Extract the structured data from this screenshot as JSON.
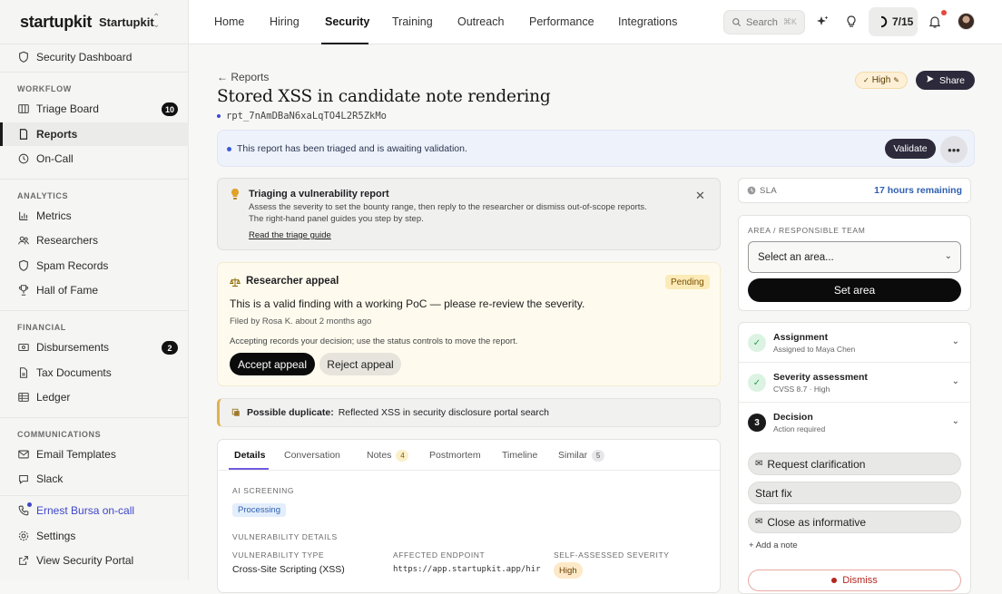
{
  "brand": {
    "logo_text": "startupkit",
    "org_name": "Startupkit"
  },
  "sidebar": {
    "top_item": {
      "label": "Security Dashboard",
      "icon": "shield-icon"
    },
    "sections": [
      {
        "title": "WORKFLOW",
        "items": [
          {
            "label": "Triage Board",
            "icon": "board-icon",
            "badge": "10"
          },
          {
            "label": "Reports",
            "icon": "document-icon",
            "active": true
          },
          {
            "label": "On-Call",
            "icon": "pager-icon"
          }
        ]
      },
      {
        "title": "ANALYTICS",
        "items": [
          {
            "label": "Metrics",
            "icon": "chart-icon"
          },
          {
            "label": "Researchers",
            "icon": "people-icon"
          },
          {
            "label": "Spam Records",
            "icon": "shield-icon"
          },
          {
            "label": "Hall of Fame",
            "icon": "trophy-icon"
          }
        ]
      },
      {
        "title": "FINANCIAL",
        "items": [
          {
            "label": "Disbursements",
            "icon": "money-icon",
            "badge": "2"
          },
          {
            "label": "Tax Documents",
            "icon": "file-icon"
          },
          {
            "label": "Ledger",
            "icon": "ledger-icon"
          }
        ]
      },
      {
        "title": "COMMUNICATIONS",
        "items": [
          {
            "label": "Email Templates",
            "icon": "mail-icon"
          },
          {
            "label": "Slack",
            "icon": "slack-icon"
          }
        ]
      }
    ],
    "footer": [
      {
        "label": "Ernest Bursa on-call",
        "icon": "phone-icon"
      },
      {
        "label": "Settings",
        "icon": "gear-icon"
      },
      {
        "label": "View Security Portal",
        "icon": "external-link-icon"
      }
    ]
  },
  "topnav": {
    "tabs": [
      "Home",
      "Hiring",
      "Security",
      "Training",
      "Outreach",
      "Performance",
      "Integrations"
    ],
    "active_tab": "Security",
    "search_placeholder": "Search",
    "search_shortcut": "⌘K",
    "progress_label": "7/15"
  },
  "report": {
    "back_label": "Reports",
    "title": "Stored XSS in candidate note rendering",
    "id": "rpt_7nAmDBaN6xaLqTO4L2R5ZkMo",
    "severity_label": "High",
    "share_label": "Share"
  },
  "banner": {
    "text": "This report has been triaged and is awaiting validation.",
    "validate_label": "Validate"
  },
  "guide": {
    "title": "Triaging a vulnerability report",
    "body_line1": "Assess the severity to set the bounty range, then reply to the researcher or dismiss out-of-scope reports.",
    "body_line2": "The right-hand panel guides you step by step.",
    "link": "Read the triage guide"
  },
  "appeal": {
    "title": "Researcher appeal",
    "status": "Pending",
    "message": "This is a valid finding with a working PoC — please re-review the severity.",
    "meta": "Filed by Rosa K. about 2 months ago",
    "note": "Accepting records your decision; use the status controls to move the report.",
    "accept_label": "Accept appeal",
    "reject_label": "Reject appeal"
  },
  "duplicate": {
    "label": "Possible duplicate:",
    "text": "Reflected XSS in security disclosure portal search"
  },
  "detail_tabs": [
    {
      "label": "Details"
    },
    {
      "label": "Conversation"
    },
    {
      "label": "Notes",
      "badge": "4"
    },
    {
      "label": "Postmortem"
    },
    {
      "label": "Timeline"
    },
    {
      "label": "Similar",
      "badge": "5"
    }
  ],
  "details": {
    "ai_label": "AI SCREENING",
    "ai_status": "Processing",
    "vuln_label": "VULNERABILITY DETAILS",
    "type_label": "VULNERABILITY TYPE",
    "type_value": "Cross-Site Scripting (XSS)",
    "endpoint_label": "AFFECTED ENDPOINT",
    "endpoint_value": "https://app.startupkit.app/hir",
    "self_sev_label": "SELF-ASSESSED SEVERITY",
    "self_sev_value": "High"
  },
  "sla": {
    "label": "SLA",
    "value": "17 hours remaining"
  },
  "area": {
    "label": "AREA / RESPONSIBLE TEAM",
    "select_value": "Select an area...",
    "button": "Set area"
  },
  "steps": [
    {
      "title": "Assignment",
      "subtitle": "Assigned to Maya Chen",
      "state": "done"
    },
    {
      "title": "Severity assessment",
      "subtitle": "CVSS 8.7 · High",
      "state": "done"
    },
    {
      "title": "Decision",
      "subtitle": "Action required",
      "state": "current",
      "number": "3"
    }
  ],
  "actions": {
    "request": "Request clarification",
    "start_fix": "Start fix",
    "close_info": "Close as informative",
    "add_note": "+ Add a note",
    "dismiss": "Dismiss"
  },
  "colors": {
    "accent": "#2d2a3b",
    "oncall": "#3f46c9",
    "sla": "#2f5fb0",
    "tab_underline": "#6f5be0"
  }
}
